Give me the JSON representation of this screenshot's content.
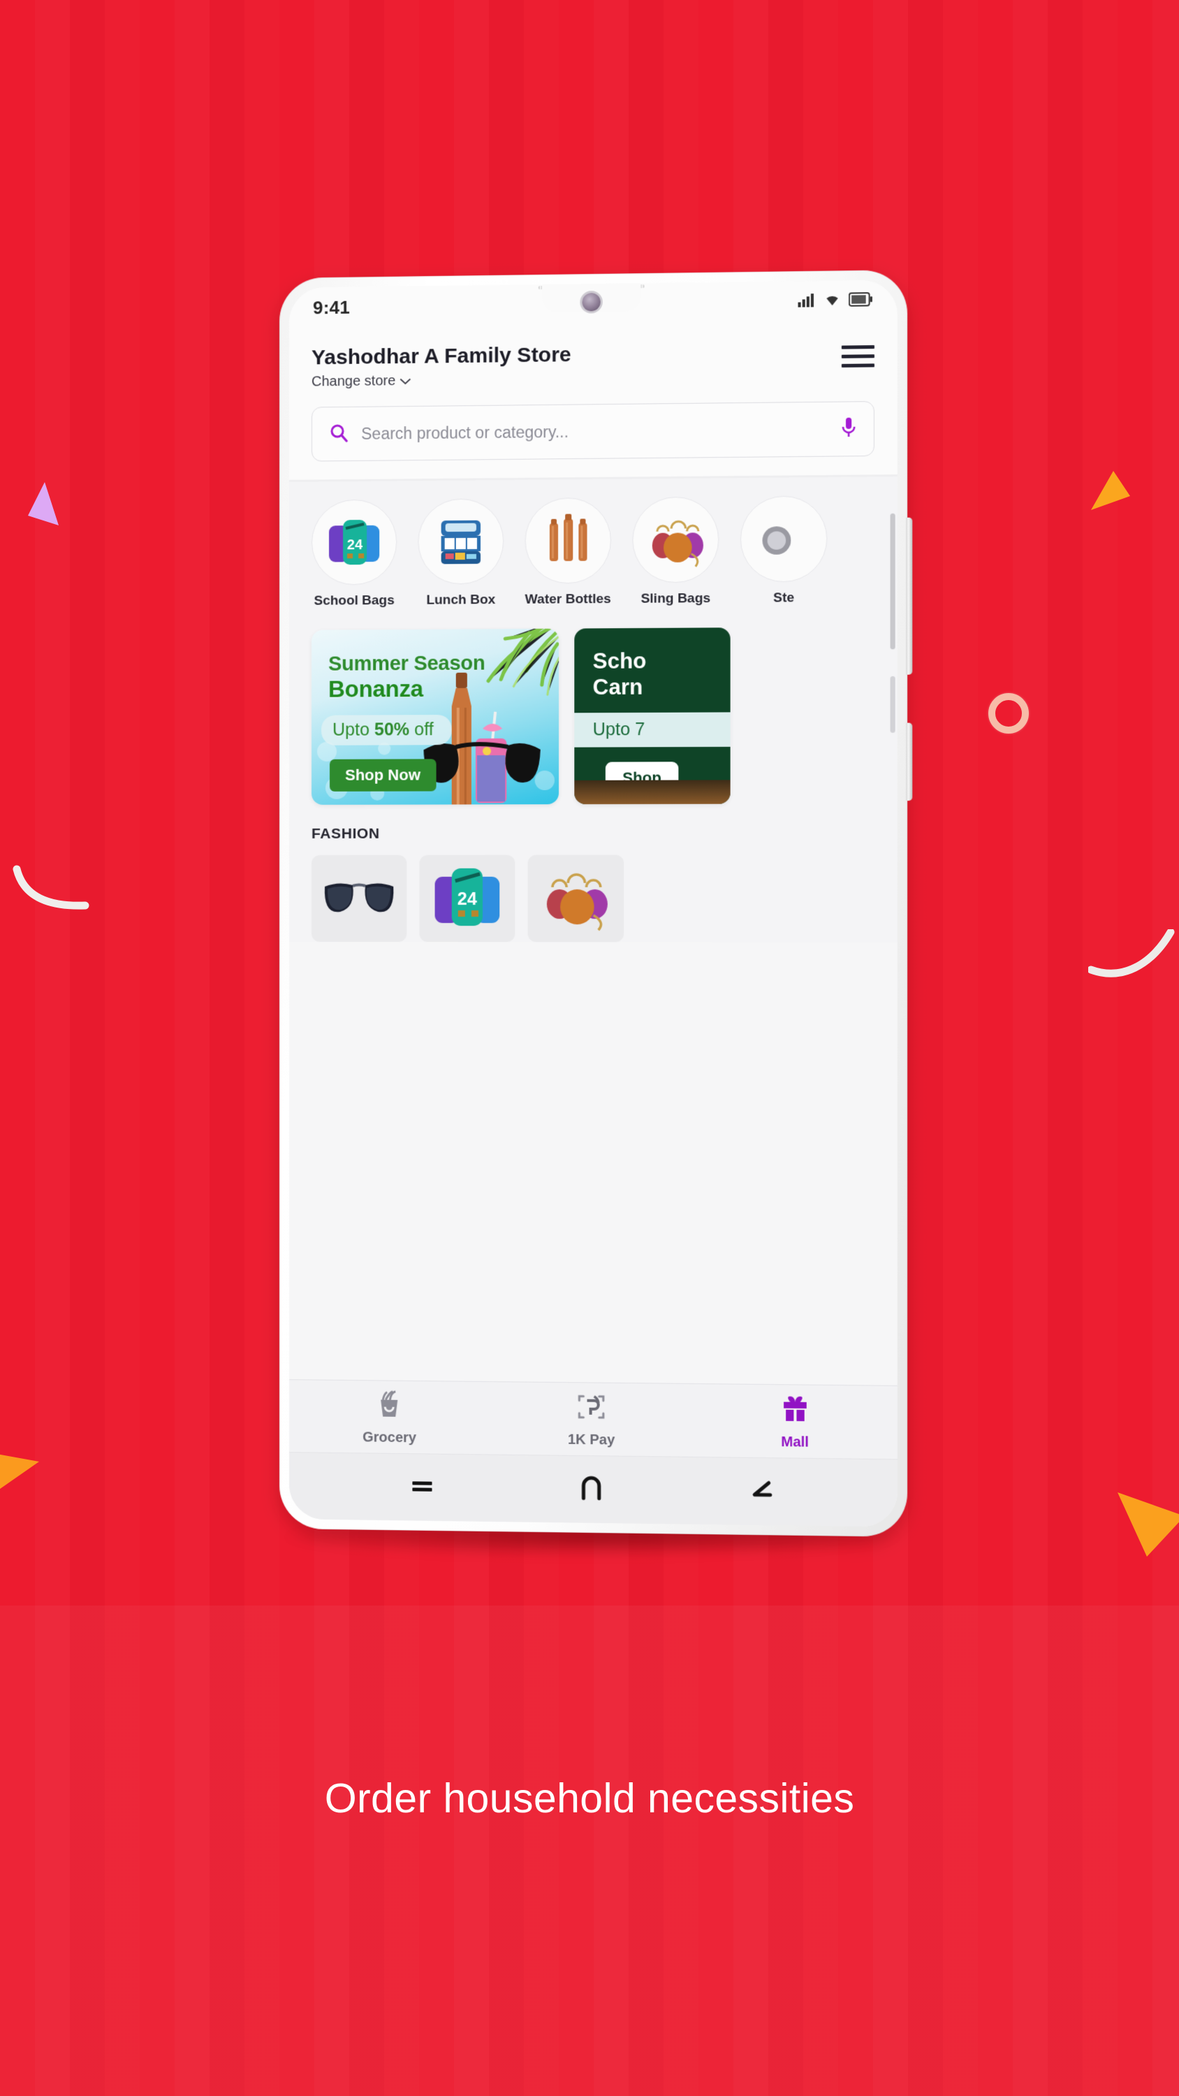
{
  "background": {
    "color": "#ED1B2F",
    "caption": "Order household necessities",
    "caption_color": "#FFFFFF"
  },
  "decorations": [
    {
      "name": "triangle-lavender",
      "color": "#DDA9F5"
    },
    {
      "name": "triangle-orange-top-right",
      "color": "#FBA61E"
    },
    {
      "name": "ring-peach",
      "color": "#F7BCA8"
    },
    {
      "name": "arc-white-left",
      "color": "#F0EEEC"
    },
    {
      "name": "arc-white-right",
      "color": "#EDEBE9"
    },
    {
      "name": "triangle-orange-bottom-left",
      "color": "#FB9A1E"
    },
    {
      "name": "triangle-orange-bottom-right",
      "color": "#FBA01E"
    }
  ],
  "phone": {
    "status_bar": {
      "time": "9:41",
      "icons": [
        "signal-icon",
        "wifi-icon",
        "battery-icon"
      ]
    },
    "header": {
      "store_name": "Yashodhar A Family Store",
      "change_store_label": "Change store",
      "chevron": "∨",
      "menu_icon": "hamburger-menu-icon"
    },
    "search": {
      "placeholder": "Search product or category...",
      "search_icon": "search-icon",
      "mic_icon": "microphone-icon",
      "accent": "#A41BD4"
    },
    "categories": [
      {
        "label": "School Bags",
        "icon": "school-bags-icon"
      },
      {
        "label": "Lunch Box",
        "icon": "lunch-box-icon"
      },
      {
        "label": "Water Bottles",
        "icon": "water-bottles-icon"
      },
      {
        "label": "Sling Bags",
        "icon": "sling-bags-icon"
      },
      {
        "label": "Ste",
        "icon": "steel-icon"
      }
    ],
    "banners": [
      {
        "title_line1": "Summer Season",
        "title_line2": "Bonanza",
        "offer_prefix": "Upto ",
        "offer_value": "50%",
        "offer_suffix": " off",
        "cta": "Shop Now",
        "text_color": "#2E8B2E"
      },
      {
        "title_line1": "Scho",
        "title_line2": "Carn",
        "offer_prefix": "Upto ",
        "offer_value": "7",
        "offer_suffix": "",
        "cta": "Shop",
        "bg_color": "#0F4427"
      }
    ],
    "fashion": {
      "heading": "FASHION",
      "tiles": [
        {
          "name": "sunglasses-tile"
        },
        {
          "name": "school-bags-tile"
        },
        {
          "name": "sling-bags-tile"
        }
      ]
    },
    "bottom_nav": [
      {
        "label": "Grocery",
        "icon": "grocery-basket-icon",
        "active": false
      },
      {
        "label": "1K Pay",
        "icon": "phonepe-scan-icon",
        "active": false
      },
      {
        "label": "Mall",
        "icon": "gift-box-icon",
        "active": true
      }
    ],
    "bottom_nav_active_color": "#9112C4",
    "android_nav": [
      {
        "name": "recents-button",
        "glyph": "≡"
      },
      {
        "name": "home-button",
        "glyph": "∩"
      },
      {
        "name": "back-button",
        "glyph": "∠"
      }
    ]
  }
}
